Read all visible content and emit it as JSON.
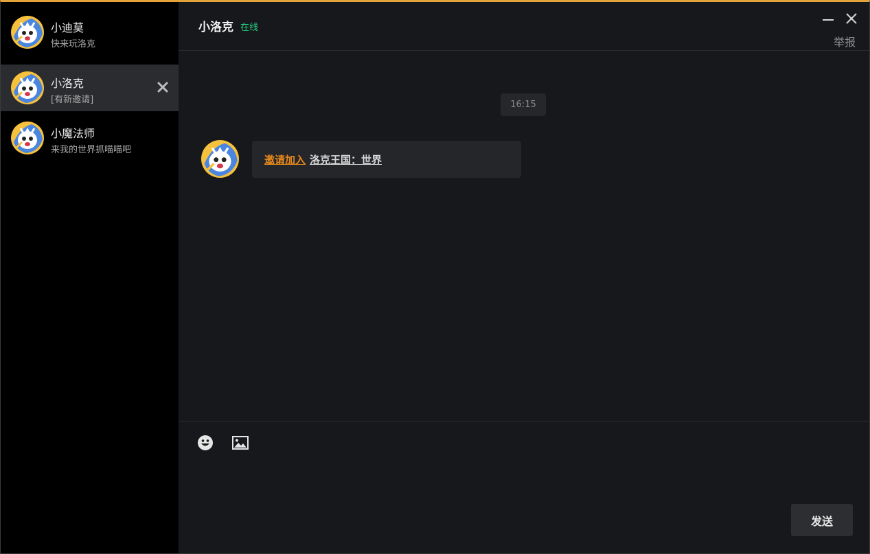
{
  "contacts": [
    {
      "name": "小迪莫",
      "preview": "快来玩洛克",
      "avatar_icon": "avatar-icon"
    },
    {
      "name": "小洛克",
      "preview": "[有新邀请]",
      "avatar_icon": "avatar-icon",
      "active": true
    },
    {
      "name": "小魔法师",
      "preview": "来我的世界抓喵喵吧",
      "avatar_icon": "avatar-icon"
    }
  ],
  "header": {
    "title": "小洛克",
    "status": "在线",
    "report_label": "举报"
  },
  "messages": {
    "timestamp": "16:15",
    "invite_label": "邀请加入",
    "world_label": "洛克王国：世界"
  },
  "composer": {
    "send_label": "发送",
    "emoji_icon": "emoji-icon",
    "image_icon": "image-icon"
  },
  "colors": {
    "accent": "#e3a23a",
    "online": "#27d07f",
    "invite": "#e88a1a"
  }
}
